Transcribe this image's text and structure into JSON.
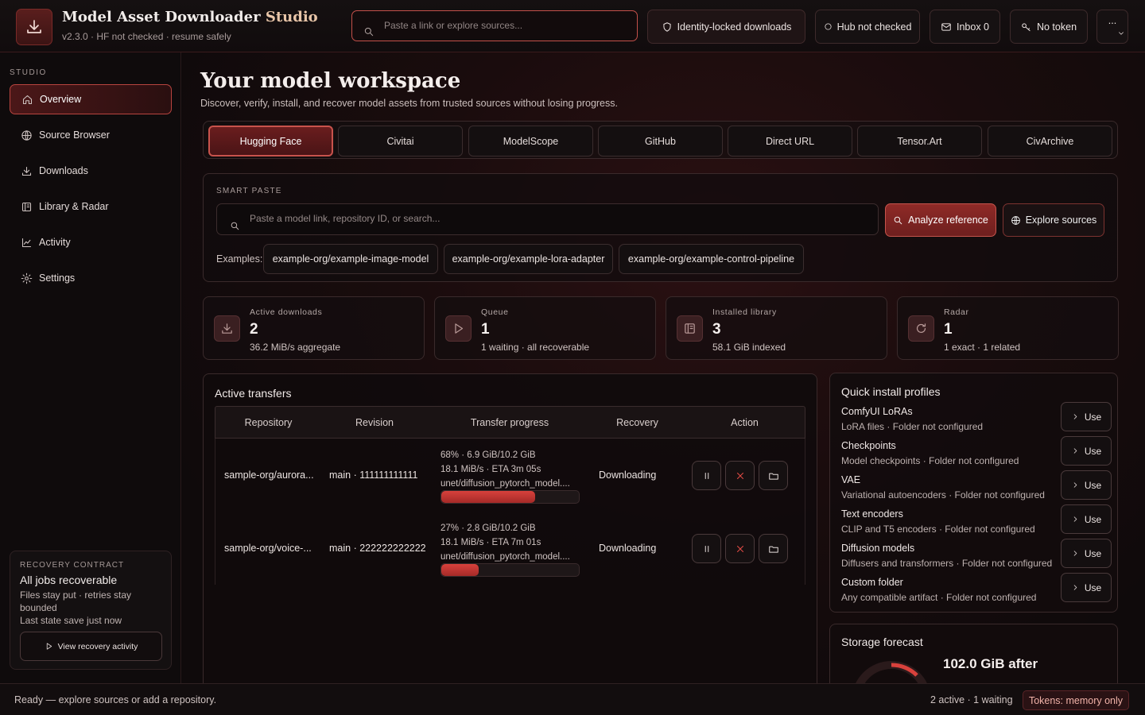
{
  "app": {
    "title_main": "Model Asset Downloader",
    "title_accent": "Studio",
    "subtitle": "v2.3.0 · HF not checked · resume safely",
    "search_placeholder": "Paste a link or explore sources..."
  },
  "topbar": {
    "identity": "Identity-locked downloads",
    "hub": "Hub not checked",
    "inbox": "Inbox 0",
    "token": "No token",
    "more": "..."
  },
  "sidebar": {
    "section": "STUDIO",
    "items": [
      {
        "label": "Overview",
        "icon": "home-icon"
      },
      {
        "label": "Source Browser",
        "icon": "globe-icon"
      },
      {
        "label": "Downloads",
        "icon": "download-icon"
      },
      {
        "label": "Library & Radar",
        "icon": "library-icon"
      },
      {
        "label": "Activity",
        "icon": "activity-icon"
      },
      {
        "label": "Settings",
        "icon": "gear-icon"
      }
    ],
    "recovery": {
      "label": "RECOVERY CONTRACT",
      "title": "All jobs recoverable",
      "line1": "Files stay put · retries stay bounded",
      "line2": "Last state save just now",
      "button": "View recovery activity"
    }
  },
  "main": {
    "title": "Your model workspace",
    "subtitle": "Discover, verify, install, and recover model assets from trusted sources without losing progress.",
    "tabs": [
      "Hugging Face",
      "Civitai",
      "ModelScope",
      "GitHub",
      "Direct URL",
      "Tensor.Art",
      "CivArchive"
    ],
    "smart_paste": {
      "label": "SMART PASTE",
      "placeholder": "Paste a model link, repository ID, or search...",
      "analyze": "Analyze reference",
      "explore": "Explore sources",
      "examples_label": "Examples:",
      "examples": [
        "example-org/example-image-model",
        "example-org/example-lora-adapter",
        "example-org/example-control-pipeline"
      ]
    },
    "stats": [
      {
        "label": "Active downloads",
        "value": "2",
        "sub": "36.2 MiB/s aggregate",
        "icon": "download-icon"
      },
      {
        "label": "Queue",
        "value": "1",
        "sub": "1 waiting · all recoverable",
        "icon": "play-icon"
      },
      {
        "label": "Installed library",
        "value": "3",
        "sub": "58.1 GiB indexed",
        "icon": "library-icon"
      },
      {
        "label": "Radar",
        "value": "1",
        "sub": "1 exact · 1 related",
        "icon": "refresh-icon"
      }
    ],
    "transfers": {
      "title": "Active transfers",
      "columns": [
        "Repository",
        "Revision",
        "Transfer progress",
        "Recovery",
        "Action"
      ],
      "rows": [
        {
          "repo": "sample-org/aurora...",
          "revision": "main · 111111111111",
          "progress_line": "68% · 6.9 GiB/10.2 GiB",
          "speed_line": "18.1 MiB/s · ETA 3m 05s",
          "file": "unet/diffusion_pytorch_model....",
          "percent": 68,
          "recovery": "Downloading"
        },
        {
          "repo": "sample-org/voice-...",
          "revision": "main · 222222222222",
          "progress_line": "27% · 2.8 GiB/10.2 GiB",
          "speed_line": "18.1 MiB/s · ETA 7m 01s",
          "file": "unet/diffusion_pytorch_model....",
          "percent": 27,
          "recovery": "Downloading"
        }
      ]
    },
    "profiles": {
      "title": "Quick install profiles",
      "use_label": "Use",
      "items": [
        {
          "name": "ComfyUI LoRAs",
          "desc": "LoRA files · Folder not configured"
        },
        {
          "name": "Checkpoints",
          "desc": "Model checkpoints · Folder not configured"
        },
        {
          "name": "VAE",
          "desc": "Variational autoencoders · Folder not configured"
        },
        {
          "name": "Text encoders",
          "desc": "CLIP and T5 encoders · Folder not configured"
        },
        {
          "name": "Diffusion models",
          "desc": "Diffusers and transformers · Folder not configured"
        },
        {
          "name": "Custom folder",
          "desc": "Any compatible artifact · Folder not configured"
        }
      ]
    },
    "storage": {
      "title": "Storage forecast",
      "value": "102.0 GiB after"
    }
  },
  "status": {
    "left": "Ready — explore sources or add a repository.",
    "counts": "2 active · 1 waiting",
    "tokens": "Tokens: memory only"
  },
  "colors": {
    "accent": "#c4504a",
    "progress": "#d8413c",
    "cancel": "#e34b45"
  }
}
